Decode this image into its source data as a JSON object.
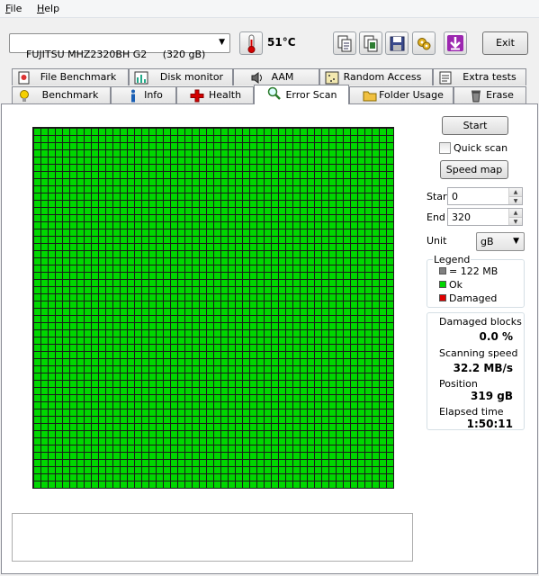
{
  "menu": {
    "items": [
      {
        "label": "File",
        "accel": "F"
      },
      {
        "label": "Help",
        "accel": "H"
      }
    ]
  },
  "toolbar": {
    "drive": "FUJITSU MHZ2320BH G2     (320 gB)",
    "temperature": "51°C",
    "exit_label": "Exit",
    "icons": [
      "copy-text-icon",
      "copy-screenshot-icon",
      "save-icon",
      "options-icon",
      "download-arrow-icon"
    ]
  },
  "tabs": {
    "top_row": [
      "File Benchmark",
      "Disk monitor",
      "AAM",
      "Random Access",
      "Extra tests"
    ],
    "bottom_row": [
      "Benchmark",
      "Info",
      "Health",
      "Error Scan",
      "Folder Usage",
      "Erase"
    ],
    "active": "Error Scan"
  },
  "controls": {
    "start_button": "Start",
    "quick_scan_label": "Quick scan",
    "quick_scan_checked": false,
    "speed_map_button": "Speed map",
    "start_label": "Start",
    "start_value": "0",
    "end_label": "End",
    "end_value": "320",
    "unit_label": "Unit",
    "unit_value": "gB"
  },
  "legend": {
    "title": "Legend",
    "items": [
      {
        "label": "= 122 MB",
        "color": "#808080"
      },
      {
        "label": "Ok",
        "color": "#00d600"
      },
      {
        "label": "Damaged",
        "color": "#e00000"
      }
    ]
  },
  "stats": {
    "damaged_blocks_label": "Damaged blocks",
    "damaged_blocks_value": "0.0 %",
    "scanning_speed_label": "Scanning speed",
    "scanning_speed_value": "32.2 MB/s",
    "position_label": "Position",
    "position_value": "319 gB",
    "elapsed_label": "Elapsed time",
    "elapsed_value": "1:50:11"
  },
  "colors": {
    "ok": "#00d600",
    "damaged": "#e00000",
    "block": "#808080"
  }
}
